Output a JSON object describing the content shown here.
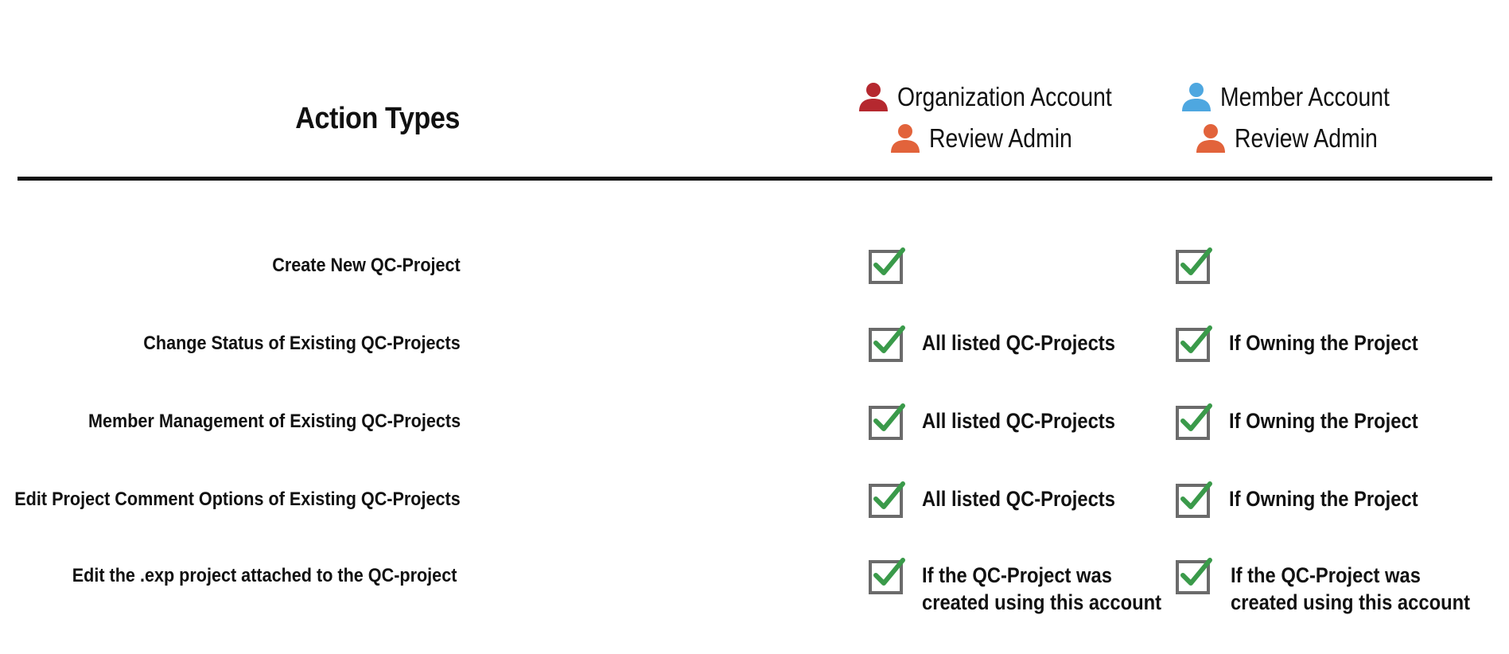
{
  "header": {
    "title": "Action Types",
    "columns": [
      {
        "roles": [
          {
            "label": "Organization Account",
            "icon": "person-icon",
            "color": "#b5282f"
          },
          {
            "label": "Review Admin",
            "icon": "person-icon",
            "color": "#e2633b"
          }
        ]
      },
      {
        "roles": [
          {
            "label": "Member Account",
            "icon": "person-icon",
            "color": "#4ea7e0"
          },
          {
            "label": "Review Admin",
            "icon": "person-icon",
            "color": "#e2633b"
          }
        ]
      }
    ]
  },
  "rows": [
    {
      "action": "Create New QC-Project",
      "org": {
        "checked": true,
        "note": ""
      },
      "member": {
        "checked": true,
        "note": ""
      }
    },
    {
      "action": "Change Status of Existing QC-Projects",
      "org": {
        "checked": true,
        "note": "All listed QC-Projects"
      },
      "member": {
        "checked": true,
        "note": "If Owning the Project"
      }
    },
    {
      "action": "Member Management of Existing QC-Projects",
      "org": {
        "checked": true,
        "note": "All listed QC-Projects"
      },
      "member": {
        "checked": true,
        "note": "If Owning the Project"
      }
    },
    {
      "action": "Edit Project Comment Options of Existing QC-Projects",
      "org": {
        "checked": true,
        "note": "All listed QC-Projects"
      },
      "member": {
        "checked": true,
        "note": "If Owning the Project"
      }
    },
    {
      "action": "Edit the .exp project attached to the QC-project",
      "org": {
        "checked": true,
        "note": "If the QC-Project was",
        "note2": "created using this account"
      },
      "member": {
        "checked": true,
        "note": "If the QC-Project was",
        "note2": "created using this account"
      }
    }
  ],
  "colors": {
    "check_green": "#3a9a4a",
    "box_gray": "#6b6b6b",
    "divider": "#111111"
  }
}
